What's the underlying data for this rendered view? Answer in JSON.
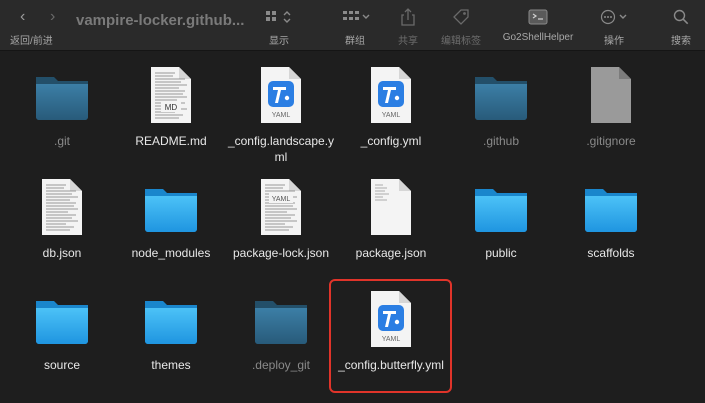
{
  "toolbar": {
    "nav_label": "返回/前进",
    "window_title": "vampire-locker.github...",
    "view_label": "显示",
    "group_label": "群组",
    "share_label": "共享",
    "edit_tags_label": "编辑标签",
    "go2shell_label": "Go2ShellHelper",
    "action_label": "操作",
    "search_label": "搜索"
  },
  "files": [
    {
      "name": ".git",
      "type": "folder-hidden"
    },
    {
      "name": "README.md",
      "type": "doc-md",
      "badge": "MD"
    },
    {
      "name": "_config.landscape.yml",
      "type": "yaml",
      "badge": "YAML"
    },
    {
      "name": "_config.yml",
      "type": "yaml",
      "badge": "YAML"
    },
    {
      "name": ".github",
      "type": "folder-hidden"
    },
    {
      "name": ".gitignore",
      "type": "doc-hidden"
    },
    {
      "name": "db.json",
      "type": "doc-text"
    },
    {
      "name": "node_modules",
      "type": "folder"
    },
    {
      "name": "package-lock.json",
      "type": "doc-text-yaml",
      "badge": "YAML"
    },
    {
      "name": "package.json",
      "type": "doc-text"
    },
    {
      "name": "public",
      "type": "folder"
    },
    {
      "name": "scaffolds",
      "type": "folder"
    },
    {
      "name": "source",
      "type": "folder"
    },
    {
      "name": "themes",
      "type": "folder"
    },
    {
      "name": ".deploy_git",
      "type": "folder-hidden"
    },
    {
      "name": "_config.butterfly.yml",
      "type": "yaml",
      "badge": "YAML",
      "selected": true
    }
  ],
  "colors": {
    "folder": "#2ea7ec",
    "folder_hidden": "#2f6c8e",
    "selection": "#e0342a",
    "yaml_badge": "#2b7ee3"
  }
}
